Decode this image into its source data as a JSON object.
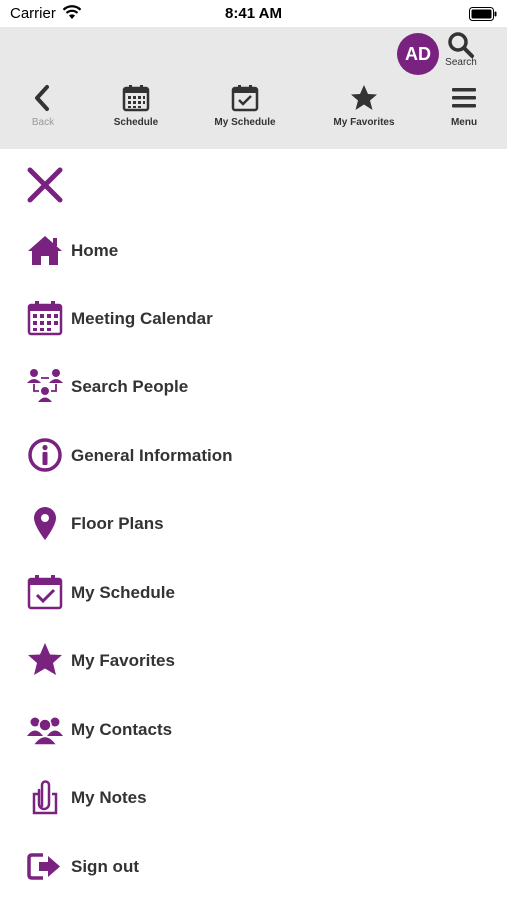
{
  "status_bar": {
    "carrier": "Carrier",
    "time": "8:41 AM"
  },
  "header": {
    "avatar_initials": "AD",
    "search_label": "Search",
    "nav": [
      {
        "label": "Back",
        "icon": "chevron-left-icon"
      },
      {
        "label": "Schedule",
        "icon": "calendar-icon"
      },
      {
        "label": "My Schedule",
        "icon": "calendar-check-icon"
      },
      {
        "label": "My Favorites",
        "icon": "star-icon"
      },
      {
        "label": "Menu",
        "icon": "hamburger-icon"
      }
    ]
  },
  "menu": {
    "close_icon": "close-icon",
    "items": [
      {
        "label": "Home",
        "icon": "home-icon"
      },
      {
        "label": "Meeting Calendar",
        "icon": "calendar-icon"
      },
      {
        "label": "Search People",
        "icon": "people-network-icon"
      },
      {
        "label": "General Information",
        "icon": "info-icon"
      },
      {
        "label": "Floor Plans",
        "icon": "map-pin-icon"
      },
      {
        "label": "My Schedule",
        "icon": "calendar-check-icon"
      },
      {
        "label": "My Favorites",
        "icon": "star-icon"
      },
      {
        "label": "My Contacts",
        "icon": "users-icon"
      },
      {
        "label": "My Notes",
        "icon": "paperclip-icon"
      },
      {
        "label": "Sign out",
        "icon": "sign-out-icon"
      }
    ]
  },
  "colors": {
    "accent": "#7a2280",
    "header_bg": "#e8e8e8",
    "text": "#333333"
  }
}
